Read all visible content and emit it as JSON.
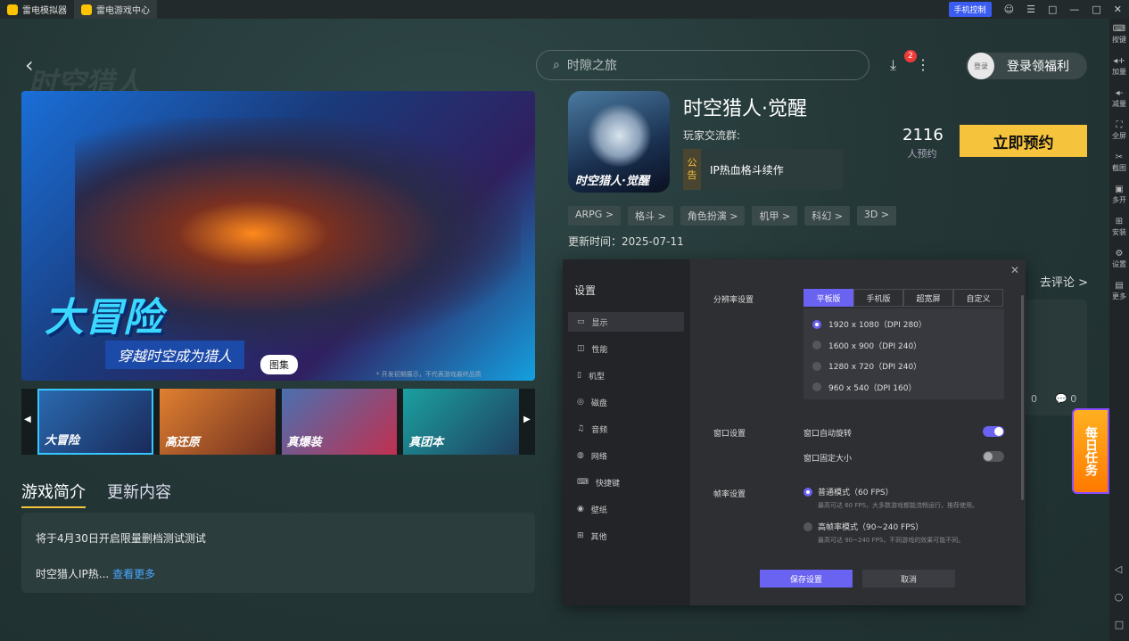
{
  "titlebar": {
    "tabs": [
      {
        "label": "雷电模拟器"
      },
      {
        "label": "雷电游戏中心"
      }
    ],
    "phone_control": "手机控制"
  },
  "rightbar": {
    "items": [
      {
        "label": "按键",
        "icon": "keyboard-icon"
      },
      {
        "label": "加量",
        "icon": "volume-up-icon"
      },
      {
        "label": "减量",
        "icon": "volume-down-icon"
      },
      {
        "label": "全屏",
        "icon": "fullscreen-icon"
      },
      {
        "label": "截图",
        "icon": "scissors-icon"
      },
      {
        "label": "多开",
        "icon": "multi-instance-icon"
      },
      {
        "label": "安装",
        "icon": "install-icon"
      },
      {
        "label": "设置",
        "icon": "gear-icon"
      },
      {
        "label": "更多",
        "icon": "more-icon"
      }
    ]
  },
  "header": {
    "search_text": "时隙之旅",
    "download_badge": "2",
    "login_avatar": "登录",
    "login_label": "登录领福利"
  },
  "watermark": "时空猎人",
  "hero": {
    "title": "大冒险",
    "subtitle": "穿越时空成为猎人",
    "gallery_label": "图集",
    "note": "* 开发初期展示，不代表游戏最终品质"
  },
  "thumbs": [
    {
      "label": "大冒险"
    },
    {
      "label": "高还原"
    },
    {
      "label": "真爆装"
    },
    {
      "label": "真团本"
    }
  ],
  "tabs": {
    "intro": "游戏简介",
    "updates": "更新内容"
  },
  "desc": {
    "line1": "将于4月30日开启限量删档测试测试",
    "line2": "时空猎人IP热...",
    "more": "查看更多"
  },
  "game": {
    "icon_text": "时空猎人·觉醒",
    "name": "时空猎人·觉醒",
    "players": "玩家交流群:",
    "notice_tag": "公告",
    "notice_text": "IP热血格斗续作",
    "reserve_count": "2116",
    "reserve_count_label": "人预约",
    "reserve_button": "立即预约",
    "tags": [
      "ARPG >",
      "格斗 >",
      "角色扮演 >",
      "机甲 >",
      "科幻 >",
      "3D >"
    ],
    "updated": "更新时间：2025-07-11"
  },
  "review": {
    "link": "去评论 >",
    "likes": "0",
    "comments": "0"
  },
  "daily": "每日任务",
  "settings": {
    "title": "设置",
    "nav": [
      {
        "label": "显示",
        "icon": "display-icon"
      },
      {
        "label": "性能",
        "icon": "performance-icon"
      },
      {
        "label": "机型",
        "icon": "phone-model-icon"
      },
      {
        "label": "磁盘",
        "icon": "disk-icon"
      },
      {
        "label": "音频",
        "icon": "audio-icon"
      },
      {
        "label": "网络",
        "icon": "network-icon"
      },
      {
        "label": "快捷键",
        "icon": "keyboard-icon"
      },
      {
        "label": "壁纸",
        "icon": "wallpaper-icon"
      },
      {
        "label": "其他",
        "icon": "other-icon"
      }
    ],
    "resolution_label": "分辨率设置",
    "segments": [
      "平板版",
      "手机版",
      "超宽屏",
      "自定义"
    ],
    "resolutions": [
      "1920 x 1080（DPI 280）",
      "1600 x 900（DPI 240）",
      "1280 x 720（DPI 240）",
      "960 x 540（DPI 160）"
    ],
    "window_label": "窗口设置",
    "auto_rotate": "窗口自动旋转",
    "fixed_size": "窗口固定大小",
    "fps_label": "帧率设置",
    "fps_normal": "普通模式（60 FPS）",
    "fps_normal_sub": "最高可达 60 FPS，大多数游戏都能流畅运行，推荐使用。",
    "fps_high": "高帧率模式（90~240 FPS）",
    "fps_high_sub": "最高可达 90~240 FPS，不同游戏的效果可能不同。",
    "save": "保存设置",
    "cancel": "取消"
  }
}
